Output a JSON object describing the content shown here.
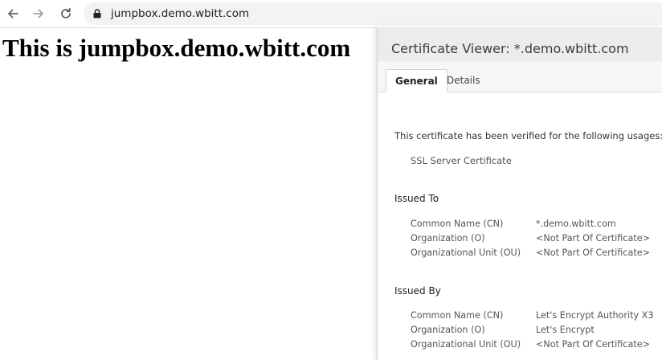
{
  "browser": {
    "url": "jumpbox.demo.wbitt.com",
    "back_icon": "back-arrow-icon",
    "forward_icon": "forward-arrow-icon",
    "reload_icon": "reload-icon",
    "lock_icon": "lock-icon"
  },
  "page": {
    "heading": "This is jumpbox.demo.wbitt.com"
  },
  "cert_viewer": {
    "title": "Certificate Viewer: *.demo.wbitt.com",
    "tabs": [
      {
        "label": "General",
        "active": true
      },
      {
        "label": "Details",
        "active": false
      }
    ],
    "verified_text": "This certificate has been verified for the following usages:",
    "usage": "SSL Server Certificate",
    "issued_to": {
      "heading": "Issued To",
      "rows": [
        {
          "label": "Common Name (CN)",
          "value": "*.demo.wbitt.com"
        },
        {
          "label": "Organization (O)",
          "value": "<Not Part Of Certificate>"
        },
        {
          "label": "Organizational Unit (OU)",
          "value": "<Not Part Of Certificate>"
        }
      ]
    },
    "issued_by": {
      "heading": "Issued By",
      "rows": [
        {
          "label": "Common Name (CN)",
          "value": "Let's Encrypt Authority X3"
        },
        {
          "label": "Organization (O)",
          "value": "Let's Encrypt"
        },
        {
          "label": "Organizational Unit (OU)",
          "value": "<Not Part Of Certificate>"
        }
      ]
    }
  },
  "colors": {
    "omnibox_bg": "#f1f3f4",
    "cert_header_bg": "#ececec"
  }
}
